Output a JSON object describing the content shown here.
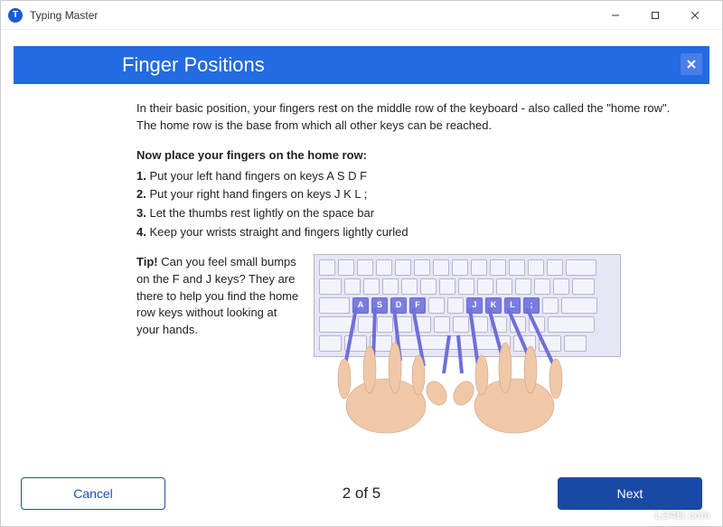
{
  "window": {
    "title": "Typing Master",
    "icon_letter": "T"
  },
  "header": {
    "title": "Finger Positions"
  },
  "lesson": {
    "intro": "In their basic position, your fingers rest on the middle row of the keyboard - also called the \"home row\". The home row is the base from which all other keys can be reached.",
    "heading": "Now place your fingers on the home row:",
    "step1_num": "1.",
    "step1": "Put your left hand fingers on keys A S D F",
    "step2_num": "2.",
    "step2": "Put your right hand fingers on keys J K L ;",
    "step3_num": "3.",
    "step3": "Let the thumbs rest lightly on the space bar",
    "step4_num": "4.",
    "step4": "Keep your wrists straight and fingers lightly curled",
    "tip_label": "Tip!",
    "tip_text": " Can you feel small bumps on the F and J keys? They are there to help you find the home row keys without looking at your hands."
  },
  "keyboard": {
    "highlighted": [
      "A",
      "S",
      "D",
      "F",
      "J",
      "K",
      "L",
      ";"
    ]
  },
  "footer": {
    "cancel": "Cancel",
    "next": "Next",
    "pager": "2 of 5"
  },
  "watermark": "LO4D.com",
  "colors": {
    "header_bg": "#226be0",
    "button_primary": "#1a48a5",
    "highlight_key": "#7a7de0"
  }
}
